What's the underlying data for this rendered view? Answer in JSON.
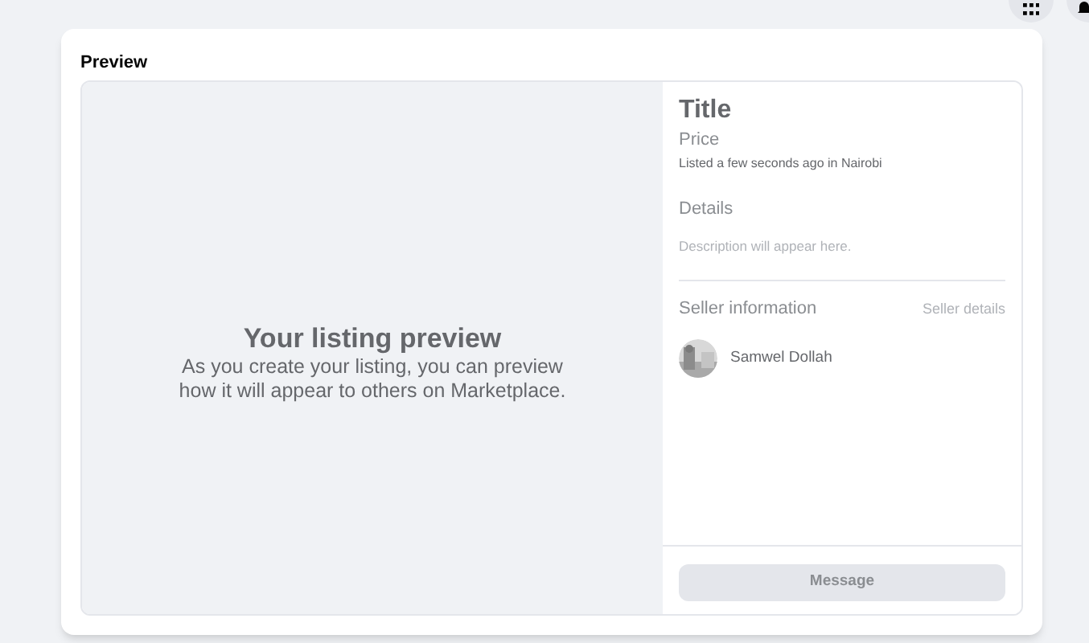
{
  "card": {
    "title": "Preview"
  },
  "preview": {
    "heading": "Your listing preview",
    "text": "As you create your listing, you can preview how it will appear to others on Marketplace."
  },
  "listing": {
    "title": "Title",
    "price": "Price",
    "listed": "Listed a few seconds ago in Nairobi",
    "details_heading": "Details",
    "description": "Description will appear here."
  },
  "seller": {
    "heading": "Seller information",
    "link": "Seller details",
    "name": "Samwel Dollah"
  },
  "message_button": {
    "label": "Message",
    "disabled": true
  }
}
